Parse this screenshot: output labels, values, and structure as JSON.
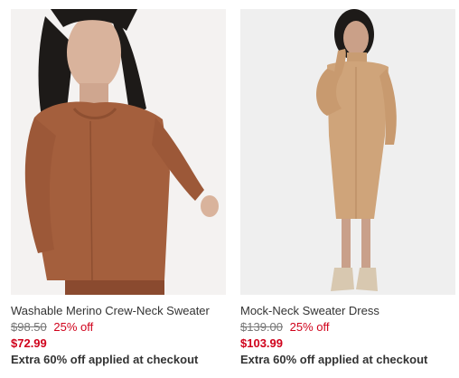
{
  "products": [
    {
      "title": "Washable Merino Crew-Neck Sweater",
      "original_price": "$98.50",
      "discount": "25% off",
      "sale_price": "$72.99",
      "promo": "Extra 60% off applied at checkout",
      "image_alt": "Woman wearing a rust brown merino crew-neck sweater"
    },
    {
      "title": "Mock-Neck Sweater Dress",
      "original_price": "$139.00",
      "discount": "25% off",
      "sale_price": "$103.99",
      "promo": "Extra 60% off applied at checkout",
      "image_alt": "Woman wearing a camel mock-neck sweater dress with ankle boots"
    }
  ],
  "colors": {
    "sale_red": "#d0021b",
    "text_dark": "#333333",
    "text_muted": "#777777",
    "sweater_rust": "#a45f3d",
    "dress_camel": "#cfa47a"
  }
}
